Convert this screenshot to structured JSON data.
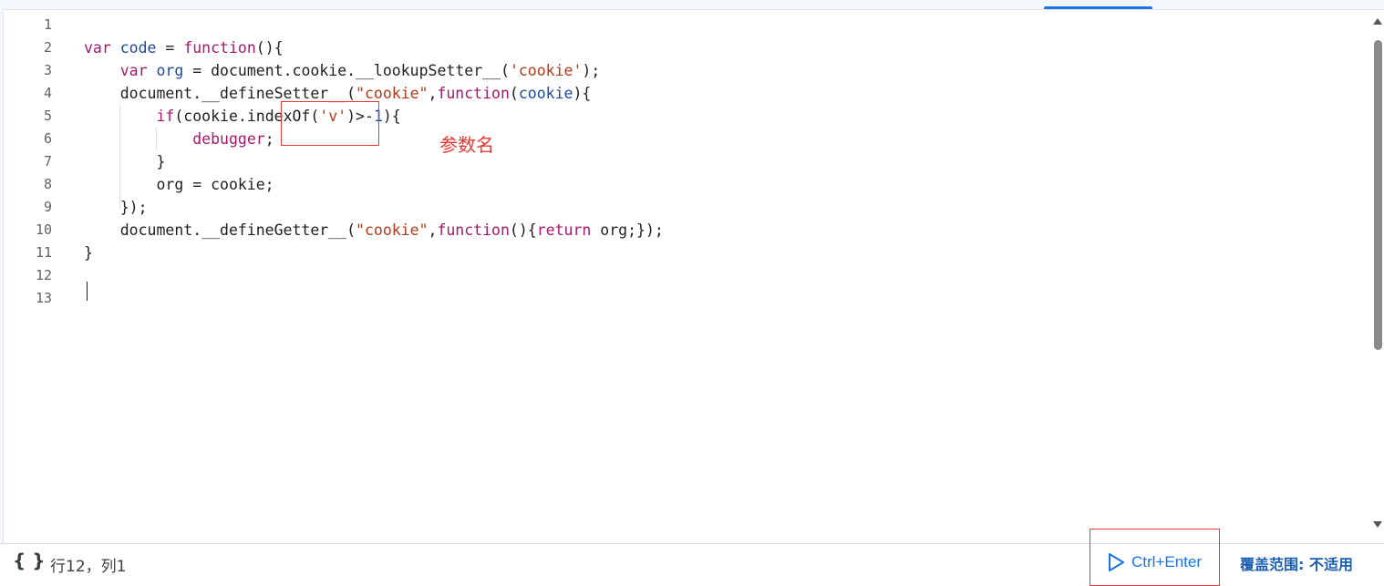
{
  "editor": {
    "line_numbers": [
      "1",
      "2",
      "3",
      "4",
      "5",
      "6",
      "7",
      "8",
      "9",
      "10",
      "11",
      "12",
      "13"
    ],
    "lines": [
      [],
      [
        {
          "t": "var",
          "c": "kw"
        },
        {
          "t": " "
        },
        {
          "t": "code",
          "c": "var"
        },
        {
          "t": " = "
        },
        {
          "t": "function",
          "c": "kw"
        },
        {
          "t": "(){"
        }
      ],
      [
        {
          "t": "    "
        },
        {
          "t": "var",
          "c": "kw"
        },
        {
          "t": " "
        },
        {
          "t": "org",
          "c": "var"
        },
        {
          "t": " = document.cookie.__lookupSetter__("
        },
        {
          "t": "'cookie'",
          "c": "str"
        },
        {
          "t": ");"
        }
      ],
      [
        {
          "t": "    document.__defineSetter__("
        },
        {
          "t": "\"cookie\"",
          "c": "str"
        },
        {
          "t": ","
        },
        {
          "t": "function",
          "c": "kw"
        },
        {
          "t": "("
        },
        {
          "t": "cookie",
          "c": "var"
        },
        {
          "t": "){"
        }
      ],
      [
        {
          "t": "        "
        },
        {
          "t": "if",
          "c": "kw"
        },
        {
          "t": "(cookie.indexOf("
        },
        {
          "t": "'v'",
          "c": "str"
        },
        {
          "t": ")>-"
        },
        {
          "t": "1",
          "c": "num"
        },
        {
          "t": "){"
        }
      ],
      [
        {
          "t": "            "
        },
        {
          "t": "debugger",
          "c": "kw"
        },
        {
          "t": ";"
        }
      ],
      [
        {
          "t": "        }"
        }
      ],
      [
        {
          "t": "        org = cookie;"
        }
      ],
      [
        {
          "t": "    });"
        }
      ],
      [
        {
          "t": "    document.__defineGetter__("
        },
        {
          "t": "\"cookie\"",
          "c": "str"
        },
        {
          "t": ","
        },
        {
          "t": "function",
          "c": "kw"
        },
        {
          "t": "(){"
        },
        {
          "t": "return",
          "c": "kw"
        },
        {
          "t": " org;});"
        }
      ],
      [
        {
          "t": "}"
        }
      ],
      [],
      []
    ]
  },
  "annotation": {
    "label": "参数名",
    "color": "#e53935"
  },
  "status": {
    "format_icon": "{ }",
    "cursor_position": "行12，列1",
    "run_shortcut": "Ctrl+Enter",
    "run_icon": "play-icon",
    "coverage_label": "覆盖范围: 不适用"
  },
  "colors": {
    "keyword": "#a4196b",
    "variable": "#1d4a9a",
    "string": "#b23a1a",
    "number": "#1c3aa0",
    "accent": "#1a73e8"
  }
}
